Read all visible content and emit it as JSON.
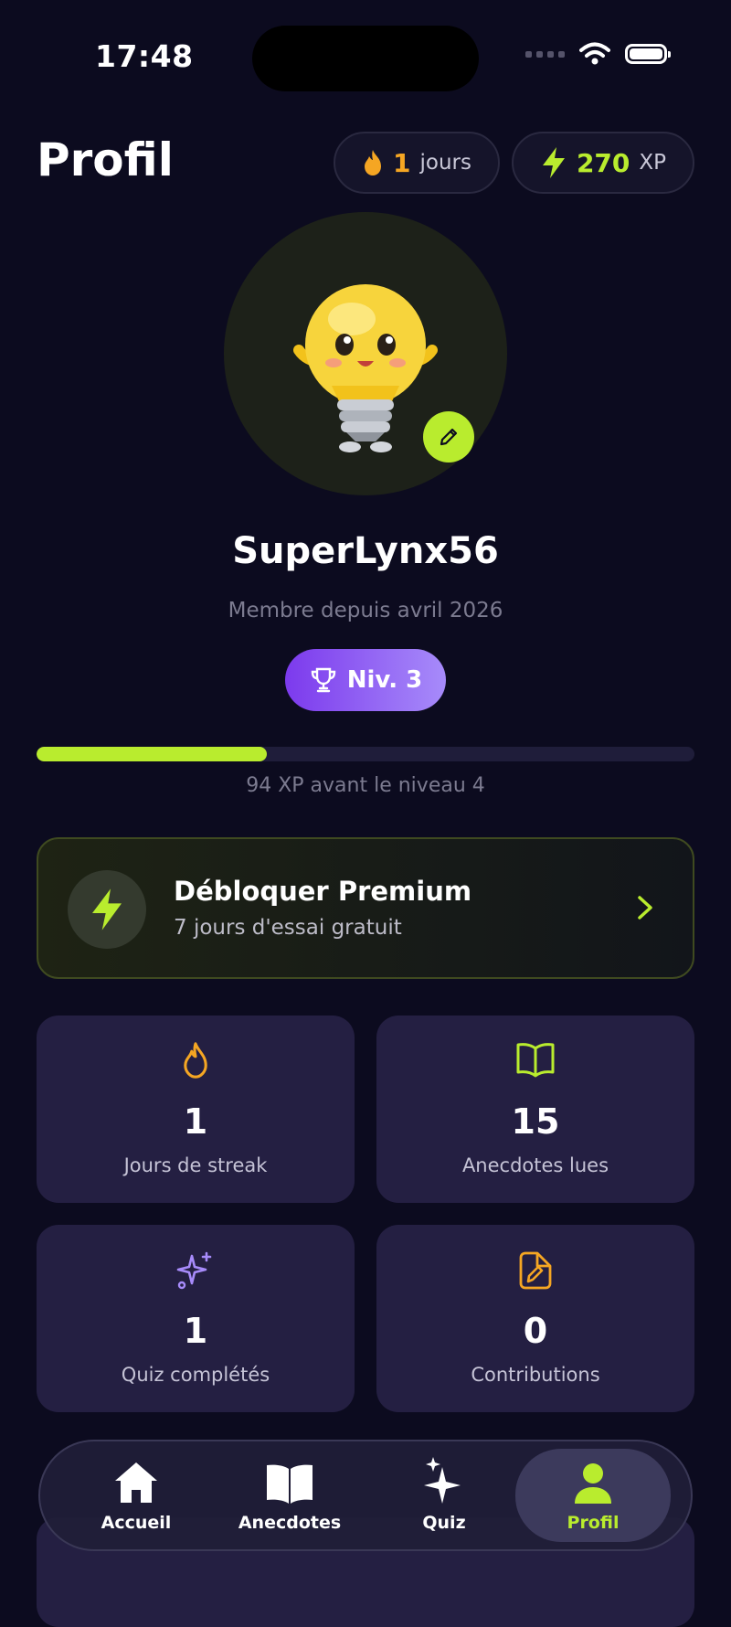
{
  "status_bar": {
    "time": "17:48"
  },
  "header": {
    "title": "Profil",
    "streak": {
      "value": "1",
      "unit": "jours"
    },
    "xp": {
      "value": "270",
      "unit": "XP"
    }
  },
  "profile": {
    "username": "SuperLynx56",
    "member_since": "Membre depuis avril 2026",
    "level_badge": "Niv. 3",
    "xp_progress_fraction": 0.35,
    "xp_caption": "94 XP avant le niveau 4"
  },
  "premium": {
    "title": "Débloquer Premium",
    "subtitle": "7 jours d'essai gratuit"
  },
  "stats": [
    {
      "icon": "flame-icon",
      "value": "1",
      "label": "Jours de streak",
      "color": "#f5a623"
    },
    {
      "icon": "book-open-icon",
      "value": "15",
      "label": "Anecdotes lues",
      "color": "#b9ec2e"
    },
    {
      "icon": "sparkles-icon",
      "value": "1",
      "label": "Quiz complétés",
      "color": "#a78bfa"
    },
    {
      "icon": "file-edit-icon",
      "value": "0",
      "label": "Contributions",
      "color": "#f5a623"
    }
  ],
  "tabs": [
    {
      "icon": "home-icon",
      "label": "Accueil"
    },
    {
      "icon": "book-icon",
      "label": "Anecdotes"
    },
    {
      "icon": "sparkles-icon",
      "label": "Quiz"
    },
    {
      "icon": "user-icon",
      "label": "Profil",
      "active": true
    }
  ],
  "colors": {
    "accent": "#b9ec2e",
    "background": "#0c0b1f",
    "card": "#241f42",
    "level_gradient": [
      "#7c3aed",
      "#a78bfa"
    ]
  }
}
